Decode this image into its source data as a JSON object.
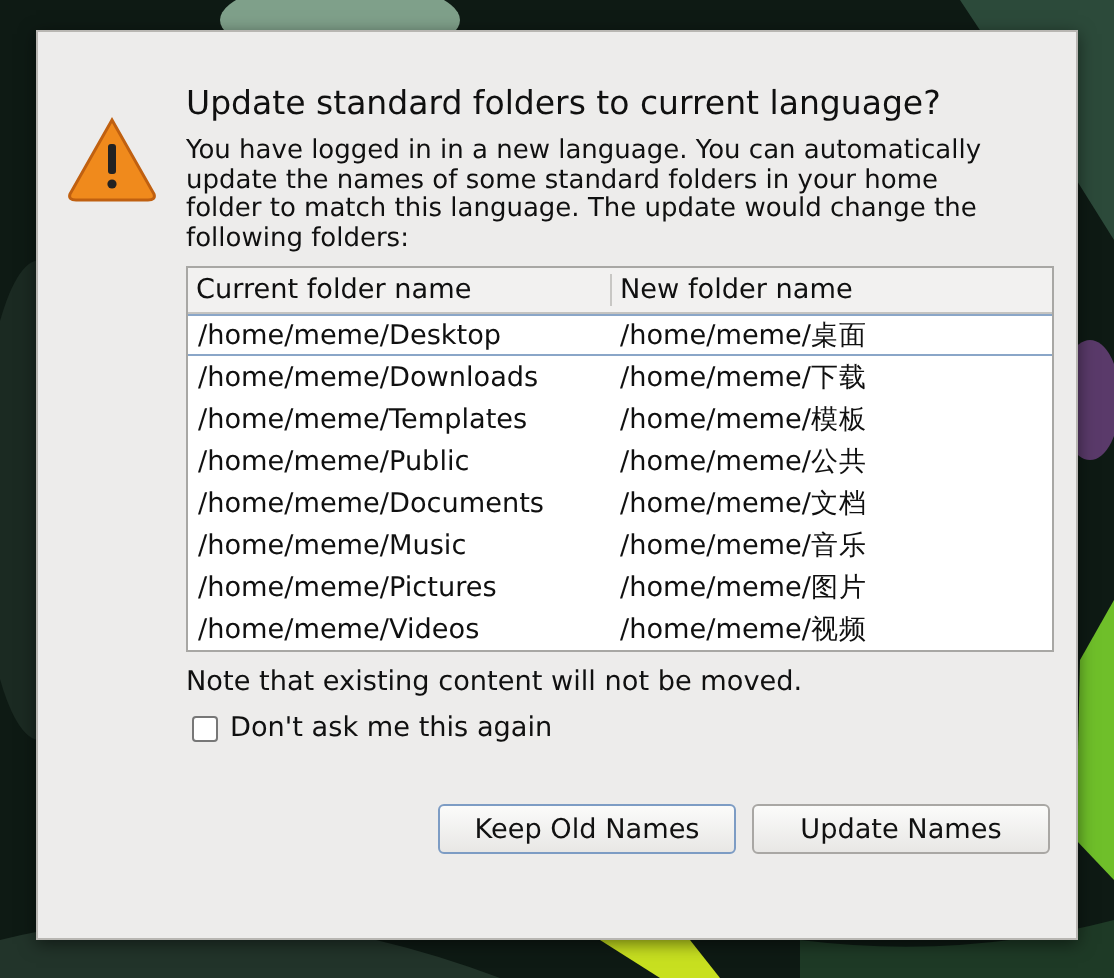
{
  "dialog": {
    "title": "Update standard folders to current language?",
    "message": "You have logged in in a new language. You can automatically update the names of some standard folders in your home folder to match this language. The update would change the following folders:",
    "table": {
      "columns": [
        "Current folder name",
        "New folder name"
      ],
      "rows": [
        {
          "current": "/home/meme/Desktop",
          "new": "/home/meme/桌面",
          "selected": true
        },
        {
          "current": "/home/meme/Downloads",
          "new": "/home/meme/下载",
          "selected": false
        },
        {
          "current": "/home/meme/Templates",
          "new": "/home/meme/模板",
          "selected": false
        },
        {
          "current": "/home/meme/Public",
          "new": "/home/meme/公共",
          "selected": false
        },
        {
          "current": "/home/meme/Documents",
          "new": "/home/meme/文档",
          "selected": false
        },
        {
          "current": "/home/meme/Music",
          "new": "/home/meme/音乐",
          "selected": false
        },
        {
          "current": "/home/meme/Pictures",
          "new": "/home/meme/图片",
          "selected": false
        },
        {
          "current": "/home/meme/Videos",
          "new": "/home/meme/视频",
          "selected": false
        }
      ]
    },
    "note": "Note that existing content will not be moved.",
    "checkbox": {
      "label": "Don't ask me this again",
      "checked": false
    },
    "buttons": [
      {
        "label": "Keep Old Names",
        "focused": true
      },
      {
        "label": "Update Names",
        "focused": false
      }
    ]
  }
}
